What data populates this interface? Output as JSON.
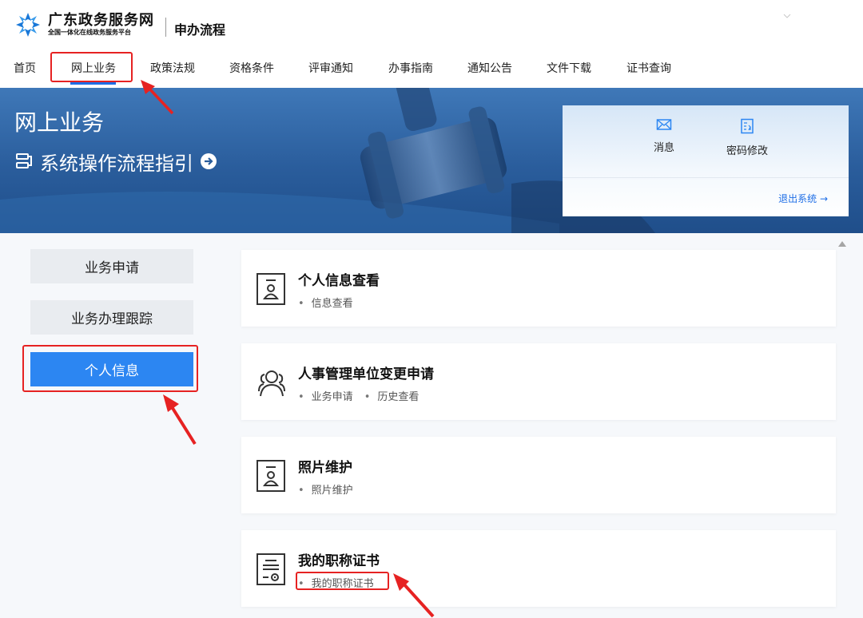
{
  "header": {
    "brand_name": "广东政务服务网",
    "brand_subtitle": "全国一体化在线政务服务平台",
    "section_title": "申办流程"
  },
  "nav": {
    "items": [
      "首页",
      "网上业务",
      "政策法规",
      "资格条件",
      "评审通知",
      "办事指南",
      "通知公告",
      "文件下载",
      "证书查询"
    ],
    "active_index": 1
  },
  "banner": {
    "title": "网上业务",
    "guide_link": "系统操作流程指引"
  },
  "panel": {
    "messages_label": "消息",
    "password_label": "密码修改",
    "logout_label": "退出系统 →"
  },
  "sidebar": {
    "items": [
      "业务申请",
      "业务办理跟踪",
      "个人信息"
    ],
    "active_index": 2
  },
  "cards": [
    {
      "title": "个人信息查看",
      "icon": "id-card-icon",
      "links": [
        "信息查看"
      ]
    },
    {
      "title": "人事管理单位变更申请",
      "icon": "users-icon",
      "links": [
        "业务申请",
        "历史查看"
      ]
    },
    {
      "title": "照片维护",
      "icon": "id-card-icon",
      "links": [
        "照片维护"
      ]
    },
    {
      "title": "我的职称证书",
      "icon": "certificate-icon",
      "links": [
        "我的职称证书"
      ]
    }
  ],
  "colors": {
    "accent": "#2c86f2",
    "link": "#1e6ee6",
    "annotation": "#e62222",
    "banner": "#2a5d9c"
  }
}
